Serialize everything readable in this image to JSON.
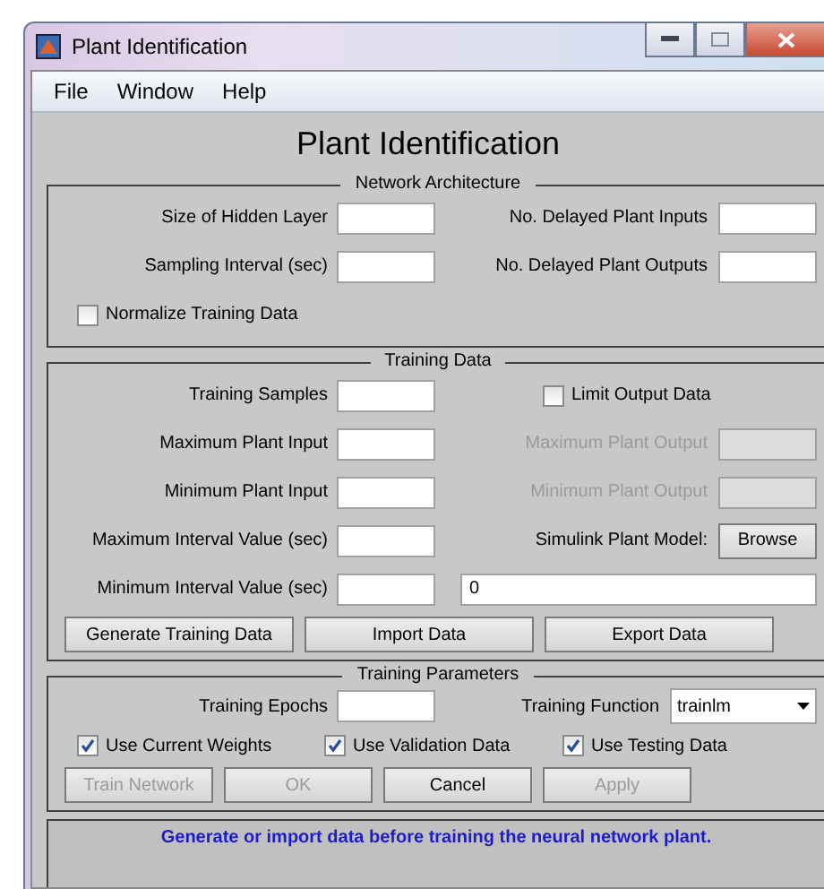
{
  "window": {
    "title": "Plant Identification"
  },
  "menu": [
    "File",
    "Window",
    "Help"
  ],
  "heading": "Plant Identification",
  "network_architecture": {
    "title": "Network Architecture",
    "rows": [
      {
        "label": "Size of Hidden Layer",
        "right": {
          "kind": "field",
          "label": "No. Delayed Plant Inputs",
          "disabled": false
        }
      },
      {
        "label": "Sampling Interval (sec)",
        "right": {
          "kind": "field",
          "label": "No. Delayed Plant Outputs",
          "disabled": false
        }
      }
    ],
    "checkbox": {
      "label": "Normalize Training Data",
      "checked": false
    }
  },
  "training_data": {
    "title": "Training Data",
    "rows": [
      {
        "label": "Training Samples",
        "right": {
          "kind": "checkbox",
          "label": "Limit Output Data",
          "checked": false
        }
      },
      {
        "label": "Maximum Plant Input",
        "right": {
          "kind": "field",
          "label": "Maximum Plant Output",
          "disabled": true
        }
      },
      {
        "label": "Minimum Plant Input",
        "right": {
          "kind": "field",
          "label": "Minimum Plant Output",
          "disabled": true
        }
      },
      {
        "label": "Maximum Interval Value (sec)",
        "right": {
          "kind": "button",
          "label": "Simulink Plant Model:",
          "button": "Browse"
        }
      },
      {
        "label": "Minimum Interval Value (sec)",
        "right": {
          "kind": "wide-field",
          "value": "0"
        }
      }
    ],
    "buttons": [
      {
        "label": "Generate Training Data",
        "disabled": false
      },
      {
        "label": "Import Data",
        "disabled": false
      },
      {
        "label": "Export Data",
        "disabled": false
      }
    ]
  },
  "training_parameters": {
    "title": "Training Parameters",
    "epochs_label": "Training Epochs",
    "function": {
      "label": "Training Function",
      "value": "trainlm"
    },
    "checkboxes": [
      {
        "label": "Use Current Weights",
        "checked": true
      },
      {
        "label": "Use Validation Data",
        "checked": true
      },
      {
        "label": "Use Testing Data",
        "checked": true
      }
    ],
    "buttons": [
      {
        "label": "Train Network",
        "disabled": true
      },
      {
        "label": "OK",
        "disabled": true
      },
      {
        "label": "Cancel",
        "disabled": false
      },
      {
        "label": "Apply",
        "disabled": true
      }
    ]
  },
  "status": "Generate or import data before training the neural network plant."
}
